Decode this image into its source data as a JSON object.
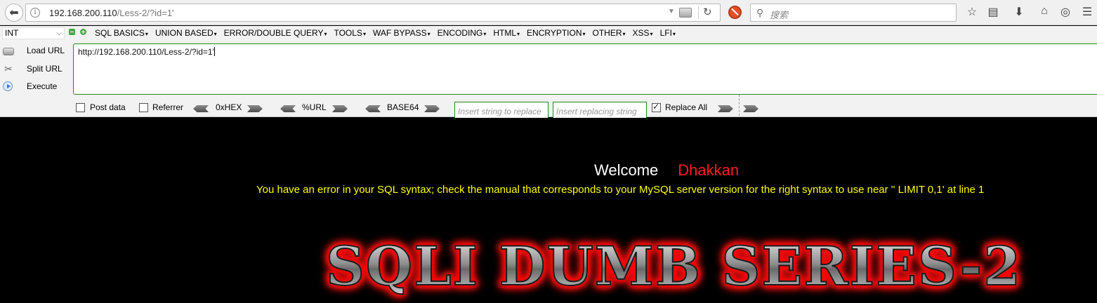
{
  "browser": {
    "url_host": "192.168.200.110",
    "url_path": "/Less-2/?id=1'",
    "search_placeholder": "搜索"
  },
  "hackbar": {
    "type_select": "INT",
    "menu": [
      "SQL BASICS",
      "UNION BASED",
      "ERROR/DOUBLE QUERY",
      "TOOLS",
      "WAF BYPASS",
      "ENCODING",
      "HTML",
      "ENCRYPTION",
      "OTHER",
      "XSS",
      "LFI"
    ],
    "load_url": "Load URL",
    "split_url": "Split URL",
    "execute": "Execute",
    "url_value": "http://192.168.200.110/Less-2/?id=1'",
    "post_data": "Post data",
    "referrer": "Referrer",
    "hex": "0xHEX",
    "url_enc": "%URL",
    "base64": "BASE64",
    "replace_placeholder": "Insert string to replace",
    "replacing_placeholder": "Insert replacing string",
    "replace_all": "Replace All",
    "post_data_checked": false,
    "referrer_checked": false,
    "replace_all_checked": true
  },
  "page": {
    "welcome": "Welcome",
    "username": "Dhakkan",
    "error": "You have an error in your SQL syntax; check the manual that corresponds to your MySQL server version for the right syntax to use near '' LIMIT 0,1' at line 1",
    "banner": "SQLI DUMB SERIES-2",
    "colors": {
      "background": "#000000",
      "welcome": "#ffffff",
      "username": "#ff1a1a",
      "error": "#ffff00",
      "banner_glow": "#ff0000"
    }
  }
}
